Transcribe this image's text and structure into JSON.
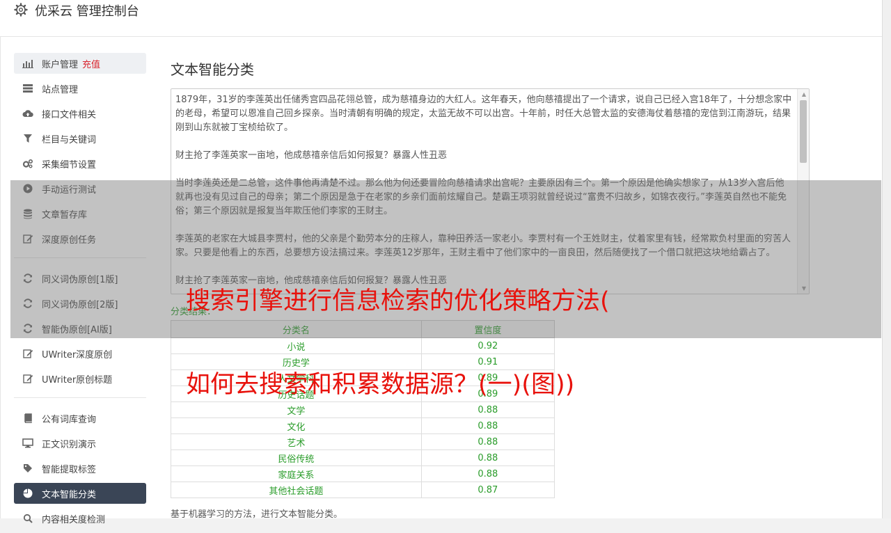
{
  "header": {
    "title": "优采云 管理控制台"
  },
  "sidebar": {
    "group1": [
      {
        "label": "账户管理",
        "icon": "bar-chart-icon",
        "badge": "充值"
      },
      {
        "label": "站点管理",
        "icon": "server-icon"
      },
      {
        "label": "接口文件相关",
        "icon": "cloud-upload-icon"
      },
      {
        "label": "栏目与关键词",
        "icon": "filter-icon"
      },
      {
        "label": "采集细节设置",
        "icon": "gears-icon"
      },
      {
        "label": "手动运行测试",
        "icon": "play-icon"
      },
      {
        "label": "文章暂存库",
        "icon": "database-icon"
      },
      {
        "label": "深度原创任务",
        "icon": "edit-icon"
      }
    ],
    "group2": [
      {
        "label": "同义词伪原创[1版]",
        "icon": "refresh-icon"
      },
      {
        "label": "同义词伪原创[2版]",
        "icon": "refresh-icon"
      },
      {
        "label": "智能伪原创[AI版]",
        "icon": "refresh-icon"
      },
      {
        "label": "UWriter深度原创",
        "icon": "edit-icon"
      },
      {
        "label": "UWriter原创标题",
        "icon": "edit-icon"
      }
    ],
    "group3": [
      {
        "label": "公有词库查询",
        "icon": "book-icon"
      },
      {
        "label": "正文识别演示",
        "icon": "monitor-icon"
      },
      {
        "label": "智能提取标签",
        "icon": "tag-icon"
      },
      {
        "label": "文本智能分类",
        "icon": "pie-chart-icon",
        "active": true
      },
      {
        "label": "内容相关度检测",
        "icon": "search-icon"
      }
    ]
  },
  "main": {
    "title": "文本智能分类",
    "input_text": "1879年，31岁的李莲英出任储秀宫四品花翎总管，成为慈禧身边的大红人。这年春天，他向慈禧提出了一个请求，说自己已经入宫18年了，十分想念家中的老母，希望可以恩准自己回乡探亲。当时清朝有明确的规定，太监无故不可以出宫。十年前，时任大总管太监的安德海仗着慈禧的宠信到江南游玩，结果刚到山东就被丁宝桢给砍了。\n\n财主抢了李莲英家一亩地，他成慈禧亲信后如何报复？暴露人性丑恶\n\n当时李莲英还是二总管，这件事他再清楚不过。那么他为何还要冒险向慈禧请求出宫呢？主要原因有三个。第一个原因是他确实想家了，从13岁入宫后他就再也没有见过自己的母亲；第二个原因是急于在老家的乡亲们面前炫耀自己。楚霸王项羽就曾经说过“富贵不归故乡，如锦衣夜行。”李莲英自然也不能免俗；第三个原因就是报复当年欺压他们李家的王财主。\n\n李莲英的老家在大城县李贾村，他的父亲是个勤劳本分的庄稼人，靠种田养活一家老小。李贾村有一个王姓财主，仗着家里有钱，经常欺负村里面的穷苦人家。只要是他看上的东西，总要想方设法搞过来。李莲英12岁那年，王财主看中了他们家中的一亩良田，然后随便找了一个借口就把这块地给霸占了。\n\n财主抢了李莲英家一亩地，他成慈禧亲信后如何报复？暴露人性丑恶",
    "result_label": "分类结果：",
    "table": {
      "headers": [
        "分类名",
        "置信度"
      ],
      "rows": [
        [
          "小说",
          "0.92"
        ],
        [
          "历史学",
          "0.91"
        ],
        [
          "人文学科",
          "0.89"
        ],
        [
          "历史话题",
          "0.89"
        ],
        [
          "文学",
          "0.88"
        ],
        [
          "文化",
          "0.88"
        ],
        [
          "艺术",
          "0.88"
        ],
        [
          "民俗传统",
          "0.88"
        ],
        [
          "家庭关系",
          "0.88"
        ],
        [
          "其他社会话题",
          "0.87"
        ]
      ]
    },
    "footnote": "基于机器学习的方法，进行文本智能分类。"
  },
  "overlay": {
    "line1": "搜索引擎进行信息检索的优化策略方法(",
    "line2": "如何去搜索和积累数据源？(一)(图))"
  }
}
